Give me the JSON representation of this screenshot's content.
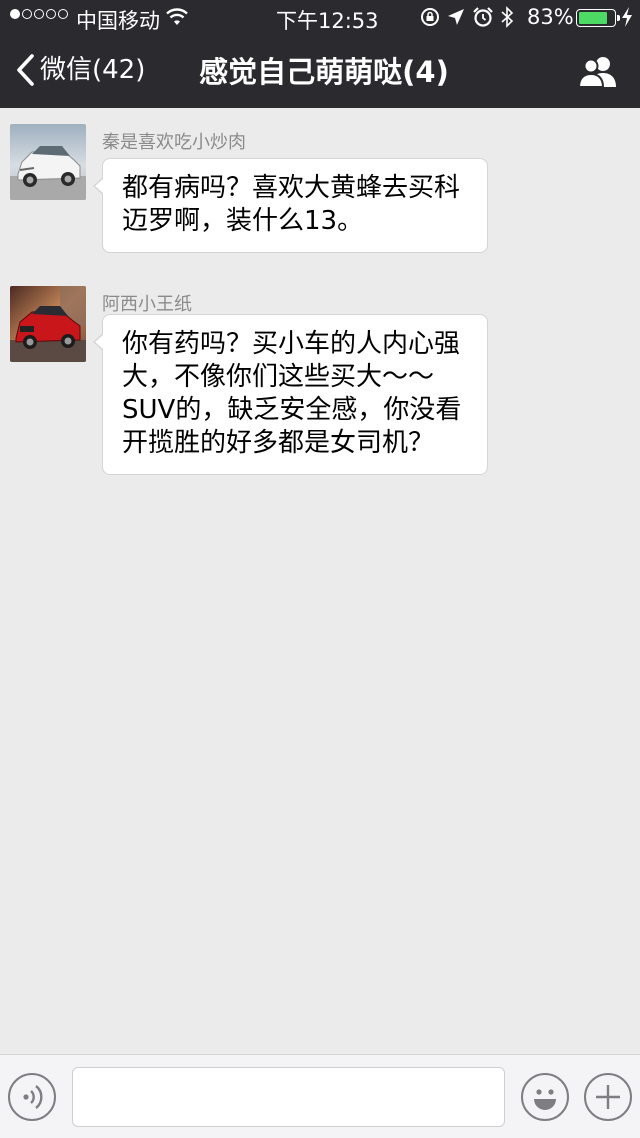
{
  "status_bar": {
    "carrier": "中国移动",
    "time": "下午12:53",
    "battery_percent": "83%",
    "battery_level": 0.83,
    "icons": [
      "signal-dots",
      "wifi-icon",
      "lock-rotation-icon",
      "location-arrow-icon",
      "alarm-icon",
      "bluetooth-icon",
      "battery-icon",
      "charging-icon"
    ]
  },
  "nav": {
    "back_label": "微信(42)",
    "title": "感觉自己萌萌哒(4)",
    "members_icon": "group-members-icon"
  },
  "messages": [
    {
      "sender": "秦是喜欢吃小炒肉",
      "text": "都有病吗？喜欢大黄蜂去买科迈罗啊，装什么13。",
      "avatar": "white-suv-avatar"
    },
    {
      "sender": "阿西小王纸",
      "text": "你有药吗？买小车的人内心强大，不像你们这些买大～～SUV的，缺乏安全感，你没看开揽胜的好多都是女司机？",
      "avatar": "red-suv-avatar"
    }
  ],
  "input_bar": {
    "text_value": "",
    "icons": [
      "voice-icon",
      "emoji-icon",
      "plus-icon"
    ]
  },
  "colors": {
    "header_bg": "#2b2a2f",
    "chat_bg": "#ebebeb",
    "bubble_bg": "#ffffff",
    "battery_green": "#4cd964"
  }
}
